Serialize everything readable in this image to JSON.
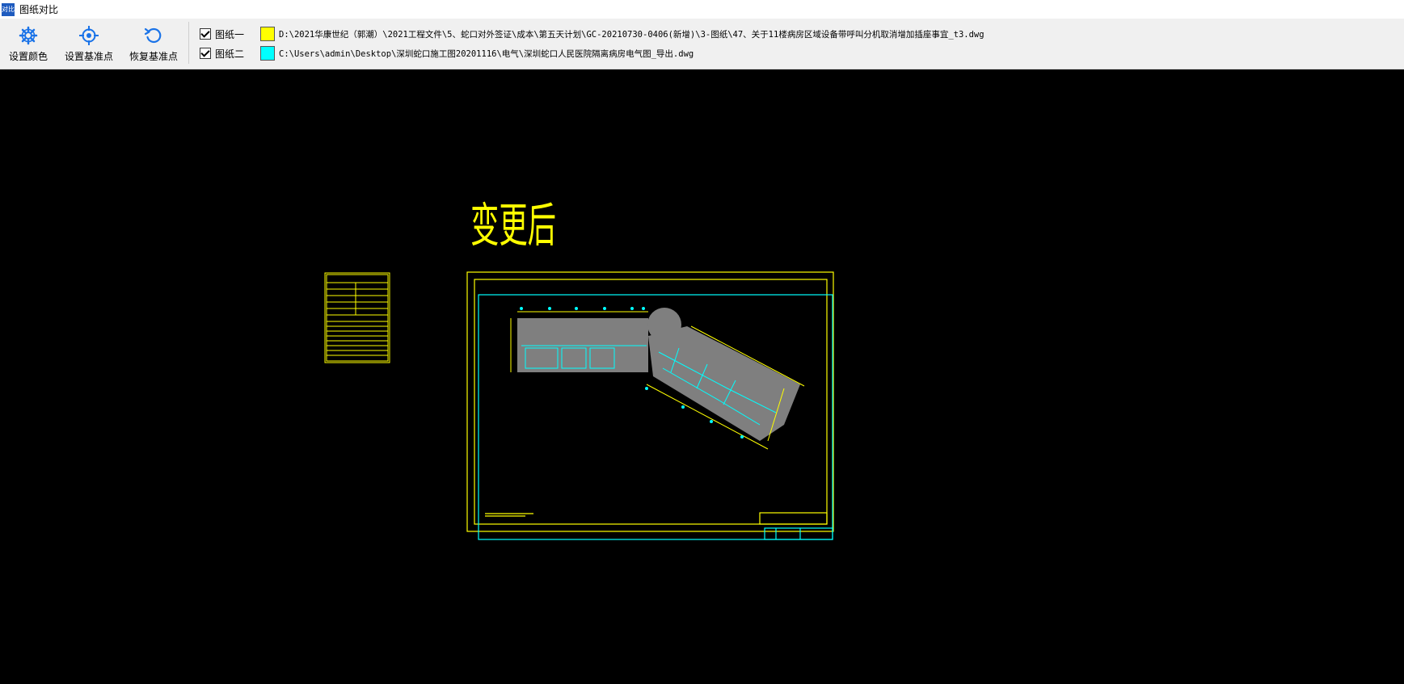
{
  "window": {
    "title": "图纸对比",
    "app_icon_text": "对比"
  },
  "toolbar": {
    "buttons": [
      {
        "label": "设置颜色",
        "icon": "gear-icon"
      },
      {
        "label": "设置基准点",
        "icon": "crosshair-icon"
      },
      {
        "label": "恢复基准点",
        "icon": "rotate-icon"
      }
    ]
  },
  "drawings": [
    {
      "checked": true,
      "label": "图纸一",
      "color": "#ffff00",
      "path": "D:\\2021华康世纪（郭潮）\\2021工程文件\\5、蛇口对外签证\\成本\\第五天计划\\GC-20210730-0406(新增)\\3-图纸\\47、关于11楼病房区域设备带呼叫分机取消增加插座事宜_t3.dwg"
    },
    {
      "checked": true,
      "label": "图纸二",
      "color": "#00ffff",
      "path": "C:\\Users\\admin\\Desktop\\深圳蛇口施工图20201116\\电气\\深圳蛇口人民医院隔离病房电气图_导出.dwg"
    }
  ],
  "canvas": {
    "annotation": "变更后"
  }
}
